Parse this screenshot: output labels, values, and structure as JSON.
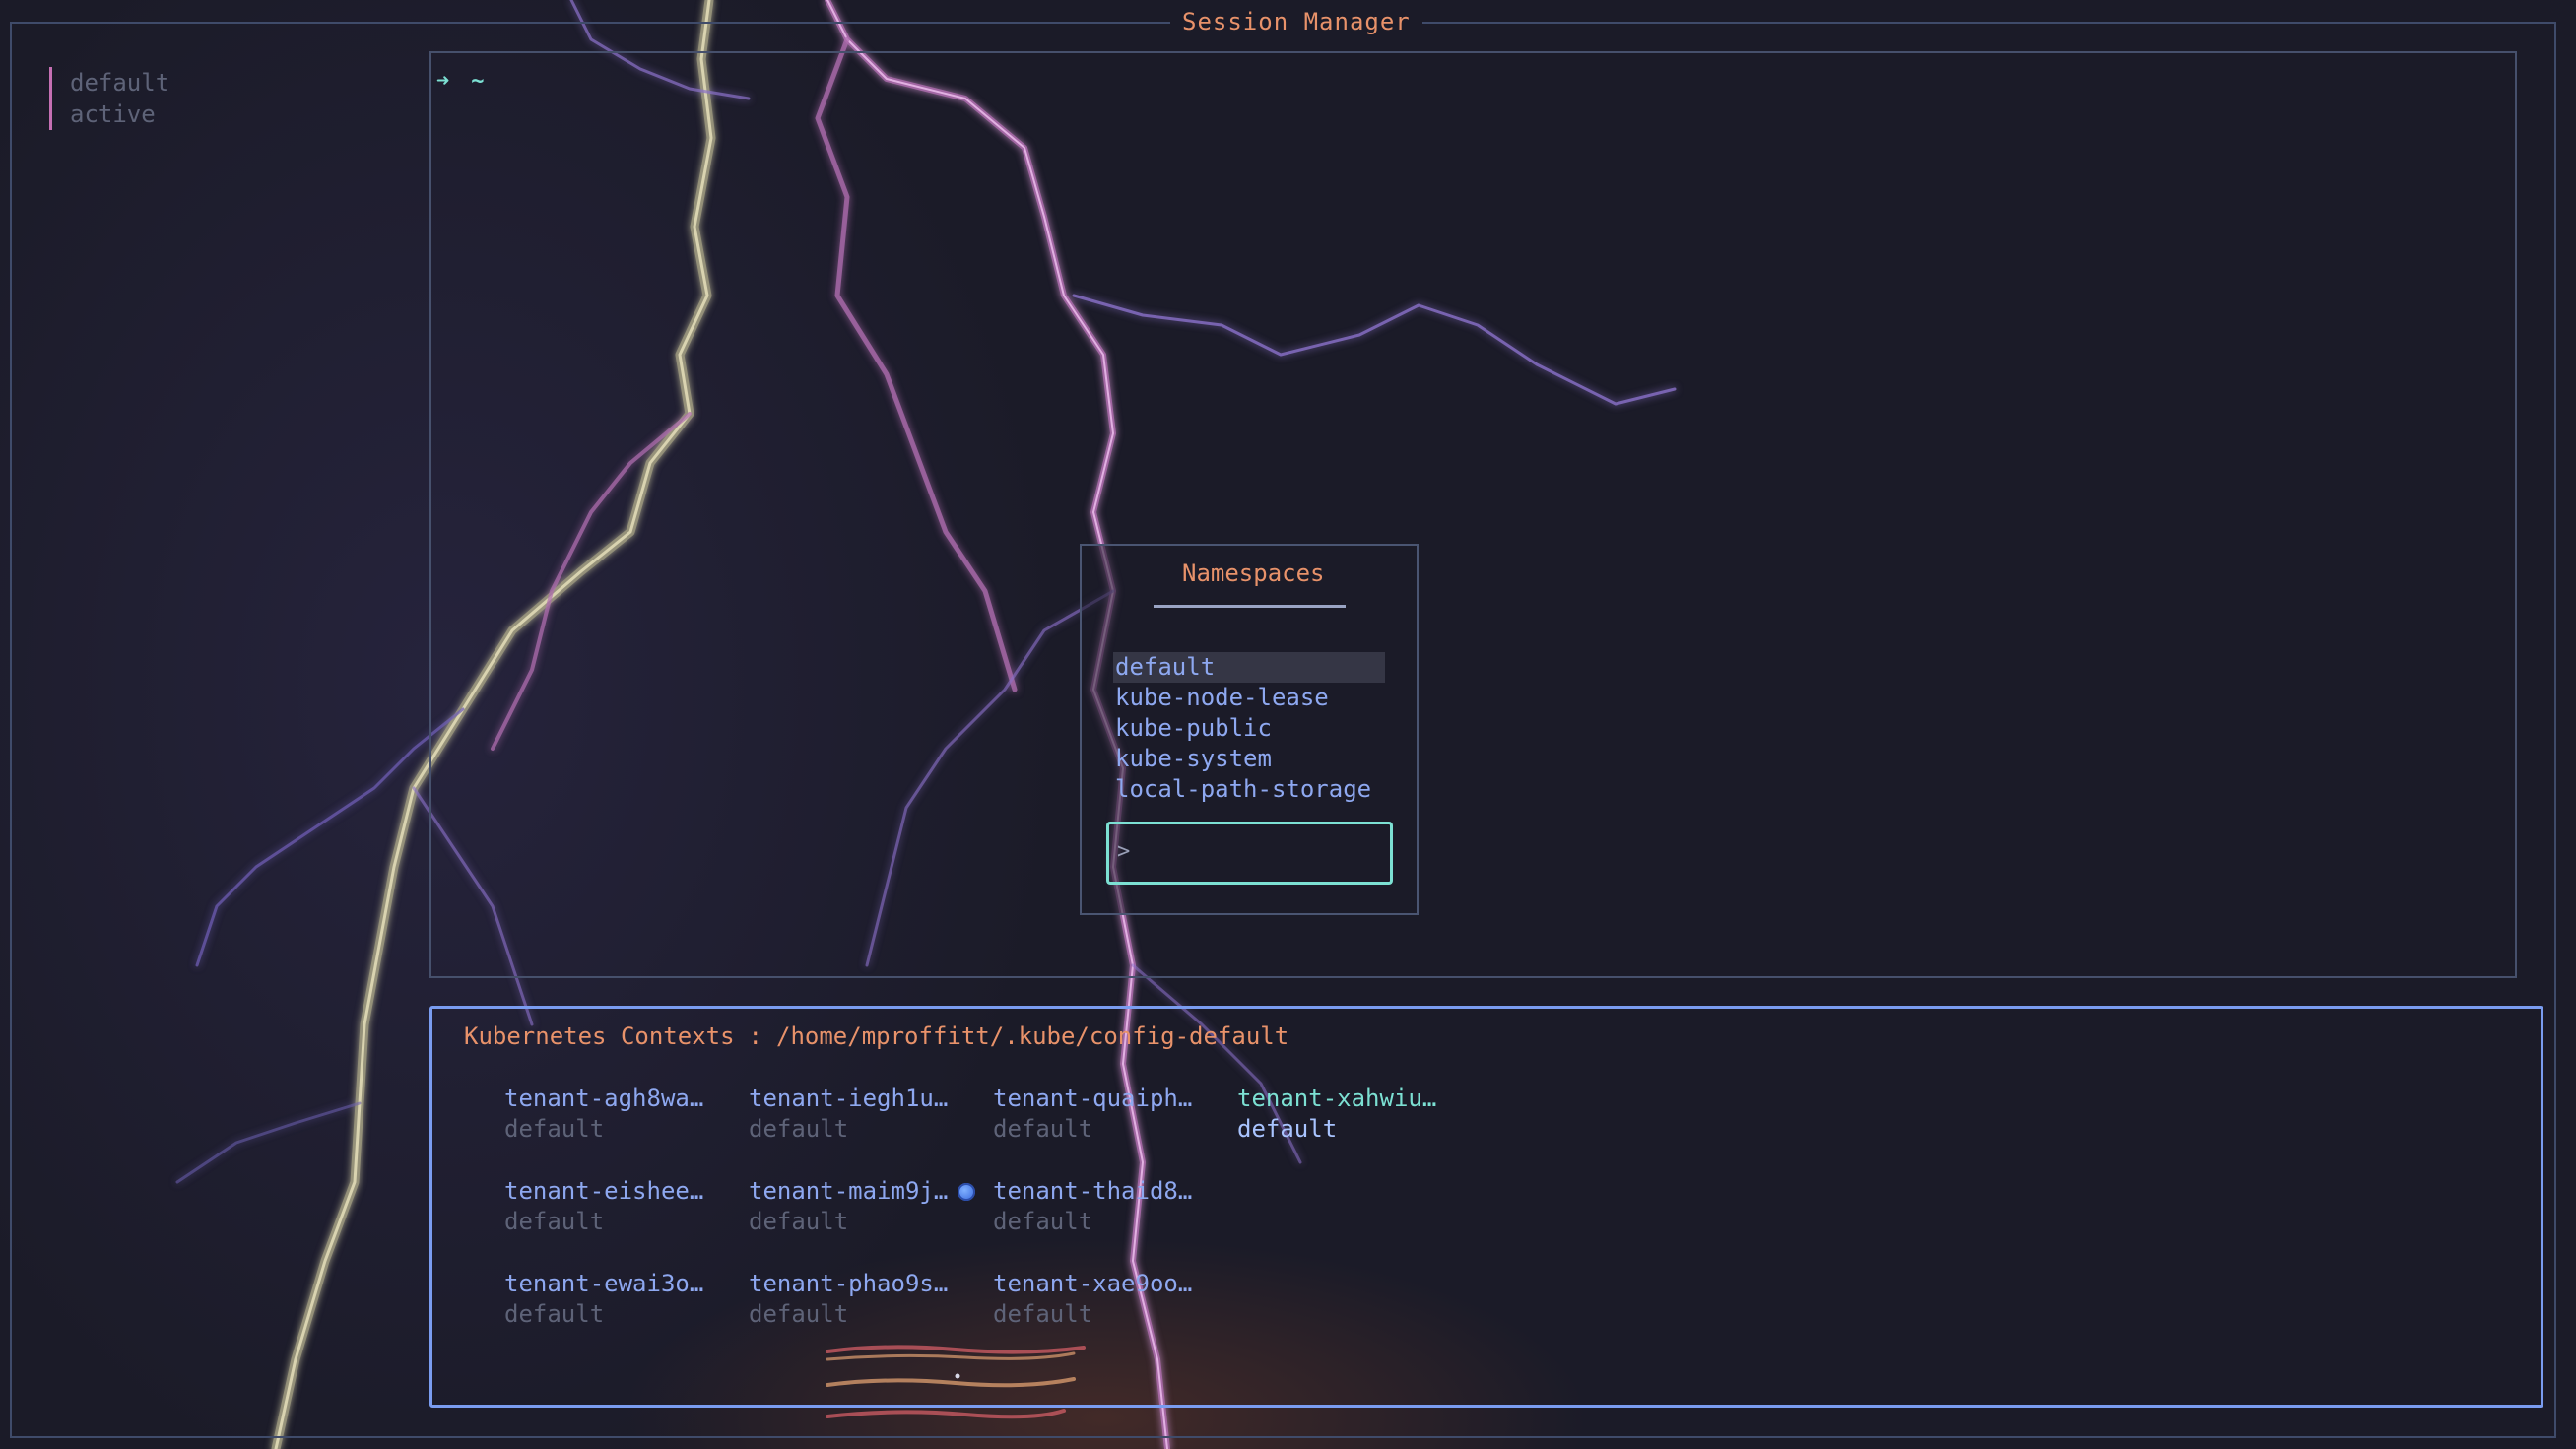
{
  "window": {
    "title": "Session Manager"
  },
  "sessions": {
    "items": [
      {
        "label": "default"
      },
      {
        "label": "active"
      }
    ]
  },
  "terminal": {
    "prompt_arrow": "➜",
    "prompt_dir": "~"
  },
  "namespaces": {
    "title": "Namespaces",
    "items": [
      {
        "label": "default",
        "selected": true
      },
      {
        "label": "kube-node-lease"
      },
      {
        "label": "kube-public"
      },
      {
        "label": "kube-system"
      },
      {
        "label": "local-path-storage"
      }
    ],
    "input_prompt": ">",
    "input_value": ""
  },
  "contexts": {
    "title": "Kubernetes Contexts",
    "separator": ":",
    "path": "/home/mproffitt/.kube/config-default",
    "items": [
      {
        "name": "tenant-agh8wa…",
        "namespace": "default"
      },
      {
        "name": "tenant-iegh1u…",
        "namespace": "default"
      },
      {
        "name": "tenant-quaiph…",
        "namespace": "default"
      },
      {
        "name": "tenant-xahwiu…",
        "namespace": "default",
        "current": true
      },
      {
        "name": "tenant-eishee…",
        "namespace": "default"
      },
      {
        "name": "tenant-maim9j…",
        "namespace": "default",
        "icon": "globe-icon"
      },
      {
        "name": "tenant-thaid8…",
        "namespace": "default"
      },
      {
        "name": "tenant-ewai3o…",
        "namespace": "default"
      },
      {
        "name": "tenant-phao9s…",
        "namespace": "default"
      },
      {
        "name": "tenant-xae9oo…",
        "namespace": "default"
      }
    ]
  },
  "colors": {
    "accent_title": "#e8926a",
    "accent_teal": "#7ce0d3",
    "item_blue": "#8ea8f0",
    "muted": "#5e6378",
    "session_bar": "#c56fb3",
    "context_border": "#7a9cf0"
  }
}
